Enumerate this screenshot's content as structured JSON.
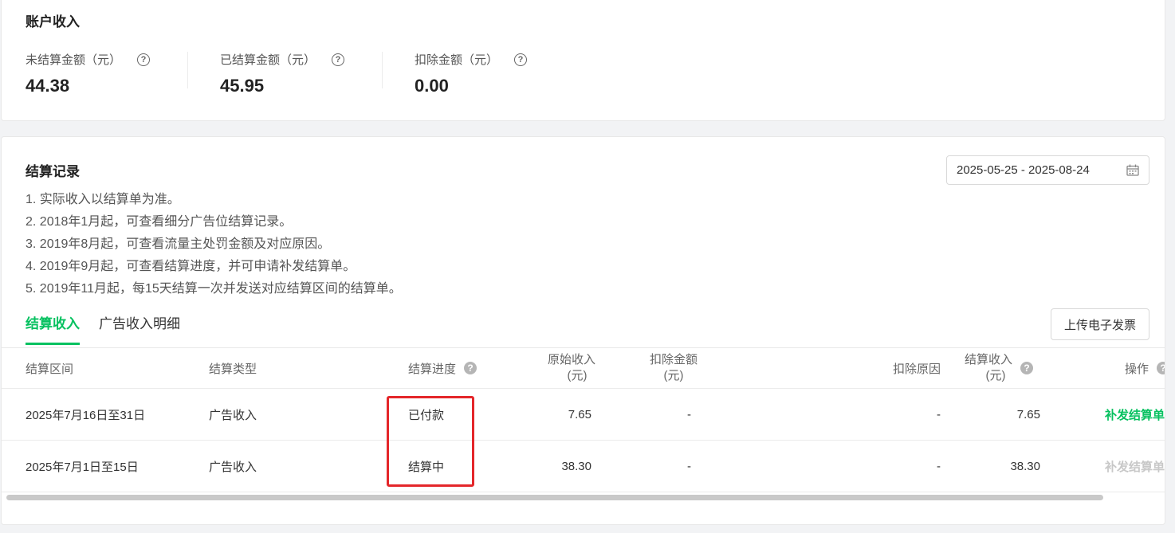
{
  "income": {
    "title": "账户收入",
    "stats": [
      {
        "label": "未结算金额（元）",
        "value": "44.38"
      },
      {
        "label": "已结算金额（元）",
        "value": "45.95"
      },
      {
        "label": "扣除金额（元）",
        "value": "0.00"
      }
    ]
  },
  "records": {
    "title": "结算记录",
    "date_range": "2025-05-25 - 2025-08-24",
    "notes": [
      "1. 实际收入以结算单为准。",
      "2. 2018年1月起，可查看细分广告位结算记录。",
      "3. 2019年8月起，可查看流量主处罚金额及对应原因。",
      "4. 2019年9月起，可查看结算进度，并可申请补发结算单。",
      "5. 2019年11月起，每15天结算一次并发送对应结算区间的结算单。"
    ],
    "tabs": [
      "结算收入",
      "广告收入明细"
    ],
    "active_tab": "结算收入",
    "upload_button": "上传电子发票"
  },
  "table": {
    "headers": {
      "period": "结算区间",
      "type": "结算类型",
      "progress": "结算进度",
      "original_1": "原始收入",
      "original_2": "(元)",
      "deduct_1": "扣除金额",
      "deduct_2": "(元)",
      "reason": "扣除原因",
      "settled_1": "结算收入",
      "settled_2": "(元)",
      "action": "操作"
    },
    "rows": [
      {
        "period": "2025年7月16日至31日",
        "type": "广告收入",
        "progress": "已付款",
        "original": "7.65",
        "deduct": "-",
        "reason": "-",
        "settled": "7.65",
        "action": "补发结算单",
        "action_enabled": true
      },
      {
        "period": "2025年7月1日至15日",
        "type": "广告收入",
        "progress": "结算中",
        "original": "38.30",
        "deduct": "-",
        "reason": "-",
        "settled": "38.30",
        "action": "补发结算单",
        "action_enabled": false
      }
    ]
  },
  "colors": {
    "accent": "#07c160",
    "highlight": "#e4262a"
  }
}
